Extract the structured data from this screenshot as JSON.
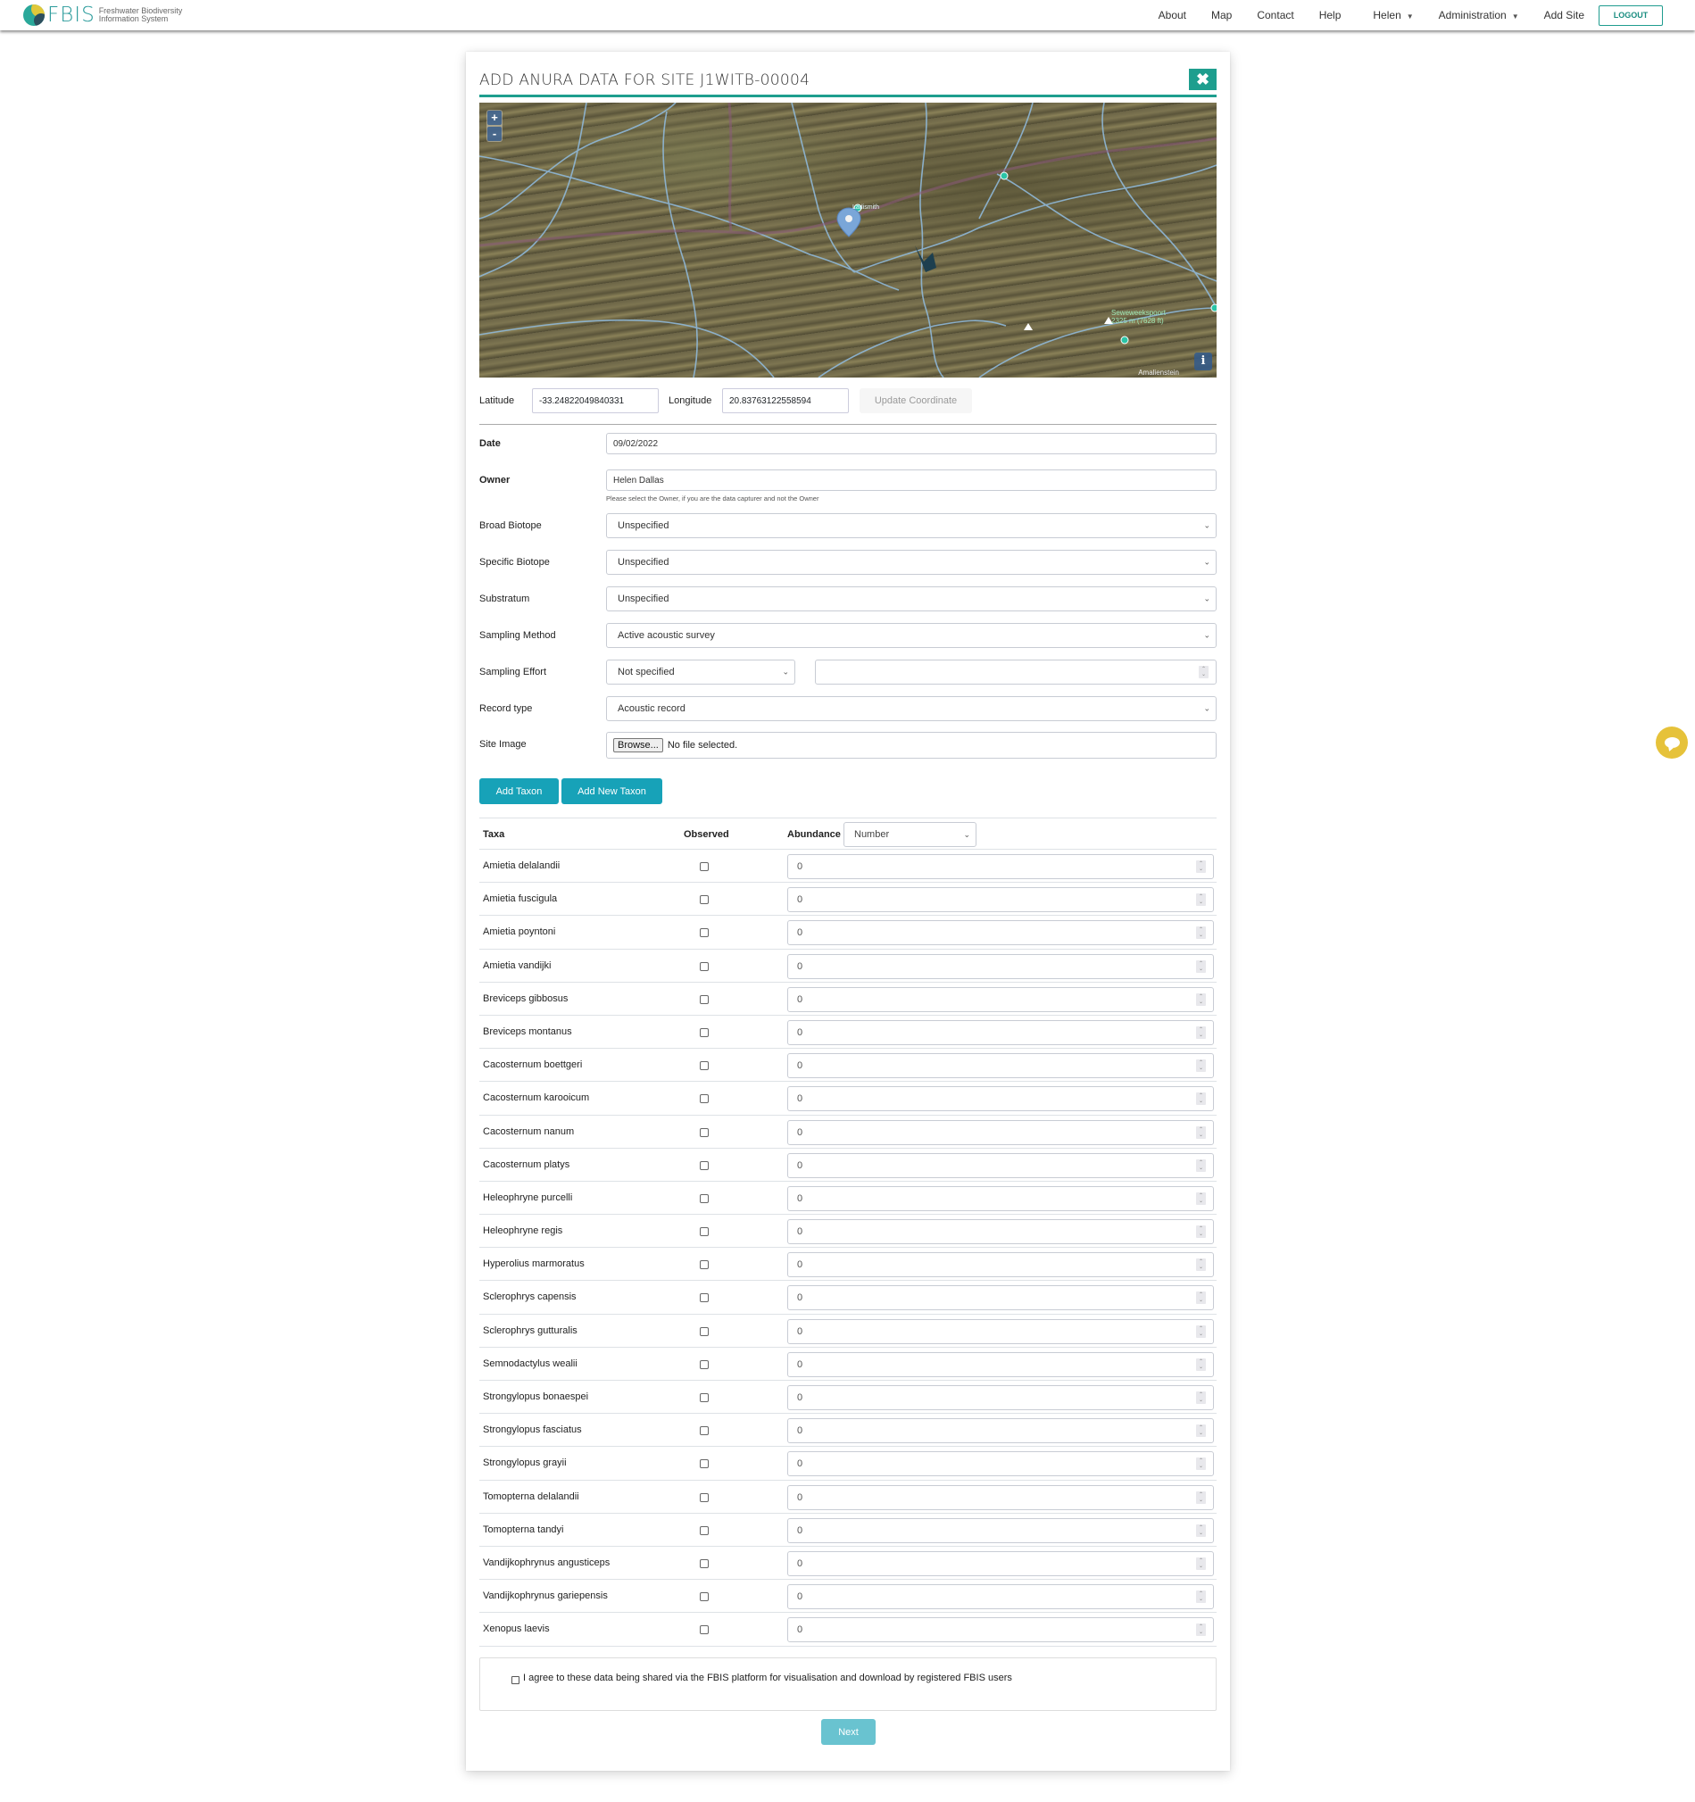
{
  "navbar": {
    "brand_name": "FBIS",
    "brand_subtitle": "Freshwater Biodiversity Information System",
    "links": [
      "About",
      "Map",
      "Contact",
      "Help"
    ],
    "user_menu": "Helen",
    "admin_menu": "Administration",
    "add_site": "Add Site",
    "logout": "LOGOUT"
  },
  "form": {
    "title": "ADD ANURA DATA FOR SITE J1WITB-00004",
    "close_icon": "close-icon",
    "map": {
      "zoom_in": "+",
      "zoom_out": "-",
      "info": "i",
      "attribution": "Amalienstein",
      "labels": [
        "Ladismith",
        "Seweweekspoort",
        "2325 m (7628 ft)"
      ]
    },
    "latitude_label": "Latitude",
    "latitude_value": "-33.24822049840331",
    "longitude_label": "Longitude",
    "longitude_value": "20.83763122558594",
    "update_coordinate": "Update Coordinate",
    "date_label": "Date",
    "date_value": "09/02/2022",
    "owner_label": "Owner",
    "owner_value": "Helen Dallas",
    "owner_help": "Please select the Owner, if you are the data capturer and not the Owner",
    "broad_biotope_label": "Broad Biotope",
    "broad_biotope_value": "Unspecified",
    "specific_biotope_label": "Specific Biotope",
    "specific_biotope_value": "Unspecified",
    "substratum_label": "Substratum",
    "substratum_value": "Unspecified",
    "sampling_method_label": "Sampling Method",
    "sampling_method_value": "Active acoustic survey",
    "sampling_effort_label": "Sampling Effort",
    "sampling_effort_value": "Not specified",
    "sampling_effort_amount": "",
    "record_type_label": "Record type",
    "record_type_value": "Acoustic record",
    "site_image_label": "Site Image",
    "browse_label": "Browse...",
    "no_file": "No file selected.",
    "add_taxon": "Add Taxon",
    "add_new_taxon": "Add New Taxon"
  },
  "taxa_table": {
    "headers": {
      "taxa": "Taxa",
      "observed": "Observed",
      "abundance": "Abundance"
    },
    "abundance_type": "Number",
    "rows": [
      {
        "taxon": "Amietia delalandii",
        "observed": false,
        "abundance": "0"
      },
      {
        "taxon": "Amietia fuscigula",
        "observed": false,
        "abundance": "0"
      },
      {
        "taxon": "Amietia poyntoni",
        "observed": false,
        "abundance": "0"
      },
      {
        "taxon": "Amietia vandijki",
        "observed": false,
        "abundance": "0"
      },
      {
        "taxon": "Breviceps gibbosus",
        "observed": false,
        "abundance": "0"
      },
      {
        "taxon": "Breviceps montanus",
        "observed": false,
        "abundance": "0"
      },
      {
        "taxon": "Cacosternum boettgeri",
        "observed": false,
        "abundance": "0"
      },
      {
        "taxon": "Cacosternum karooicum",
        "observed": false,
        "abundance": "0"
      },
      {
        "taxon": "Cacosternum nanum",
        "observed": false,
        "abundance": "0"
      },
      {
        "taxon": "Cacosternum platys",
        "observed": false,
        "abundance": "0"
      },
      {
        "taxon": "Heleophryne purcelli",
        "observed": false,
        "abundance": "0"
      },
      {
        "taxon": "Heleophryne regis",
        "observed": false,
        "abundance": "0"
      },
      {
        "taxon": "Hyperolius marmoratus",
        "observed": false,
        "abundance": "0"
      },
      {
        "taxon": "Sclerophrys capensis",
        "observed": false,
        "abundance": "0"
      },
      {
        "taxon": "Sclerophrys gutturalis",
        "observed": false,
        "abundance": "0"
      },
      {
        "taxon": "Semnodactylus wealii",
        "observed": false,
        "abundance": "0"
      },
      {
        "taxon": "Strongylopus bonaespei",
        "observed": false,
        "abundance": "0"
      },
      {
        "taxon": "Strongylopus fasciatus",
        "observed": false,
        "abundance": "0"
      },
      {
        "taxon": "Strongylopus grayii",
        "observed": false,
        "abundance": "0"
      },
      {
        "taxon": "Tomopterna delalandii",
        "observed": false,
        "abundance": "0"
      },
      {
        "taxon": "Tomopterna tandyi",
        "observed": false,
        "abundance": "0"
      },
      {
        "taxon": "Vandijkophrynus angusticeps",
        "observed": false,
        "abundance": "0"
      },
      {
        "taxon": "Vandijkophrynus gariepensis",
        "observed": false,
        "abundance": "0"
      },
      {
        "taxon": "Xenopus laevis",
        "observed": false,
        "abundance": "0"
      }
    ]
  },
  "agreement": {
    "checked": false,
    "text": "I agree to these data being shared via the FBIS platform for visualisation and download by registered FBIS users"
  },
  "next_label": "Next",
  "chat_icon": "chat-bubble-icon",
  "colors": {
    "brand_teal": "#1e9e8e",
    "button_info": "#17a2b8",
    "next_disabled": "#69c3d0",
    "chat_yellow": "#e6c23a"
  }
}
